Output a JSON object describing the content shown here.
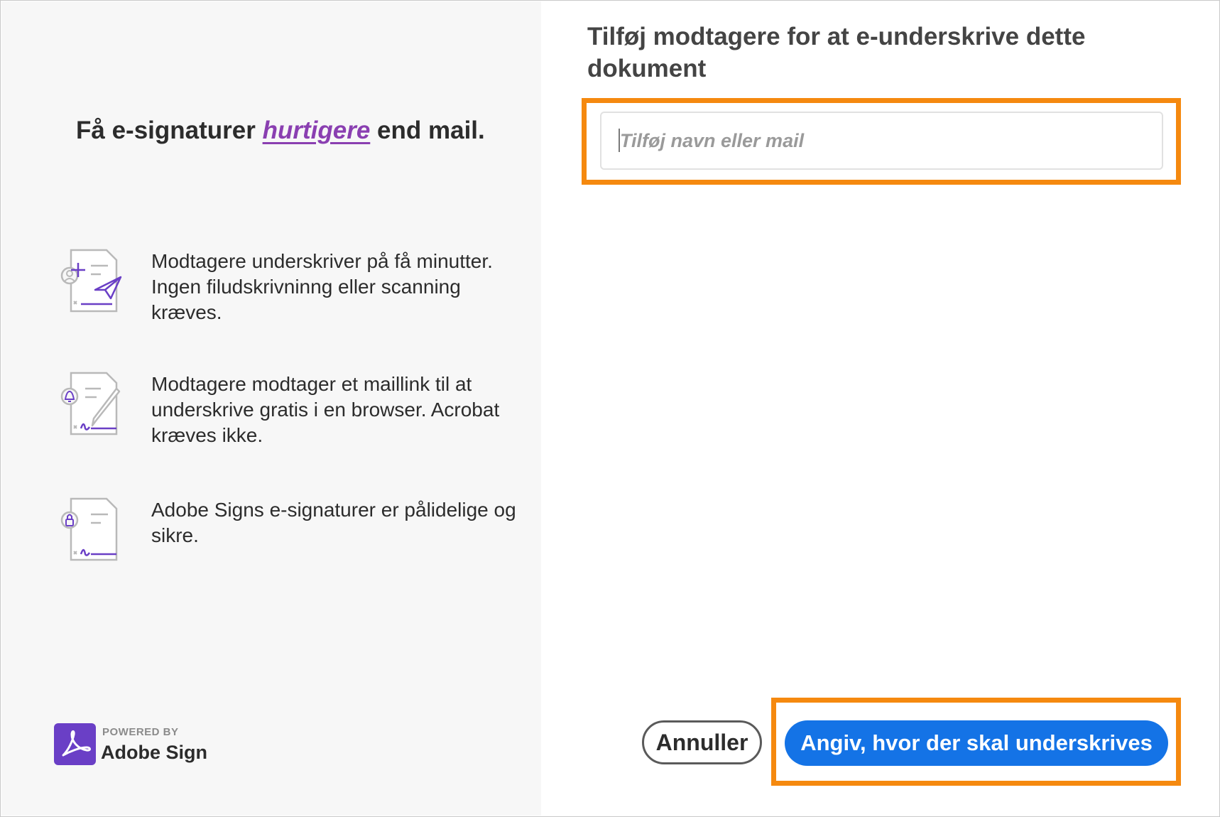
{
  "colors": {
    "accent_purple": "#8a3fb1",
    "icon_violet": "#6a3fc6",
    "primary_blue": "#1473e6",
    "highlight_orange": "#f5890f",
    "left_panel_bg": "#f7f7f7"
  },
  "left_panel": {
    "headline": {
      "before": "Få e-signaturer",
      "accent": "hurtigere",
      "after": "end mail."
    },
    "features": [
      {
        "icon": "send-document-icon",
        "text": "Modtagere underskriver på få minutter. Ingen filudskrivninng eller scanning kræves."
      },
      {
        "icon": "sign-document-bell-icon",
        "text": "Modtagere modtager et maillink til at underskrive gratis i en browser. Acrobat kræves ikke."
      },
      {
        "icon": "secure-document-lock-icon",
        "text": "Adobe Signs e-signaturer er pålidelige og sikre."
      }
    ],
    "brand": {
      "powered_by": "POWERED BY",
      "product": "Adobe Sign",
      "icon": "adobe-acrobat-logo-icon"
    }
  },
  "main": {
    "title": "Tilføj modtagere for at e-underskrive dette dokument",
    "recipient_input": {
      "placeholder": "Tilføj navn eller mail",
      "value": ""
    },
    "buttons": {
      "cancel": "Annuller",
      "primary": "Angiv, hvor der skal underskrives"
    }
  }
}
